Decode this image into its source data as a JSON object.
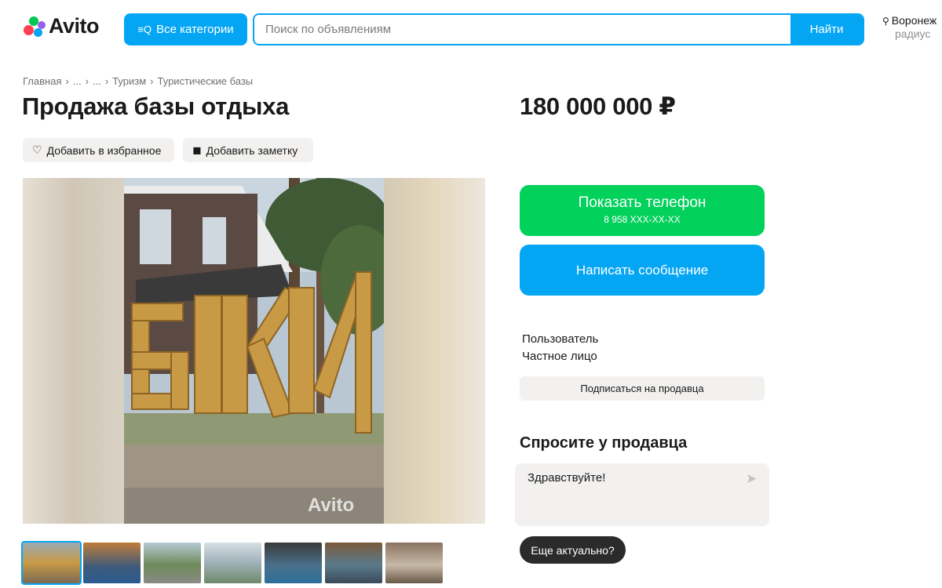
{
  "header": {
    "logo_text": "Avito",
    "categories_label": "Все категории",
    "search_placeholder": "Поиск по объявлениям",
    "search_button": "Найти",
    "location": "Воронеж",
    "location_sub": "радиус"
  },
  "breadcrumb": [
    "Главная",
    "›",
    "...",
    "›",
    "...",
    "›",
    "Туризм",
    "›",
    "Туристические базы"
  ],
  "listing": {
    "title": "Продажа базы отдыха",
    "price": "180 000 000 ₽",
    "favorite_label": "Добавить в избранное",
    "note_label": "Добавить заметку",
    "watermark": "Avito",
    "thumbnail_count": 7
  },
  "contact": {
    "phone_label": "Показать телефон",
    "phone_masked": "8 958 XXX-XX-XX",
    "message_label": "Написать сообщение"
  },
  "seller": {
    "label": "Пользователь",
    "type": "Частное лицо",
    "subscribe_label": "Подписаться на продавца"
  },
  "ask": {
    "title": "Спросите у продавца",
    "message_text": "Здравствуйте!",
    "quick_reply": "Еще актуально?"
  },
  "colors": {
    "brand_blue": "#04a6f4",
    "green": "#02d15c",
    "pill_bg": "#f2f1f0"
  }
}
